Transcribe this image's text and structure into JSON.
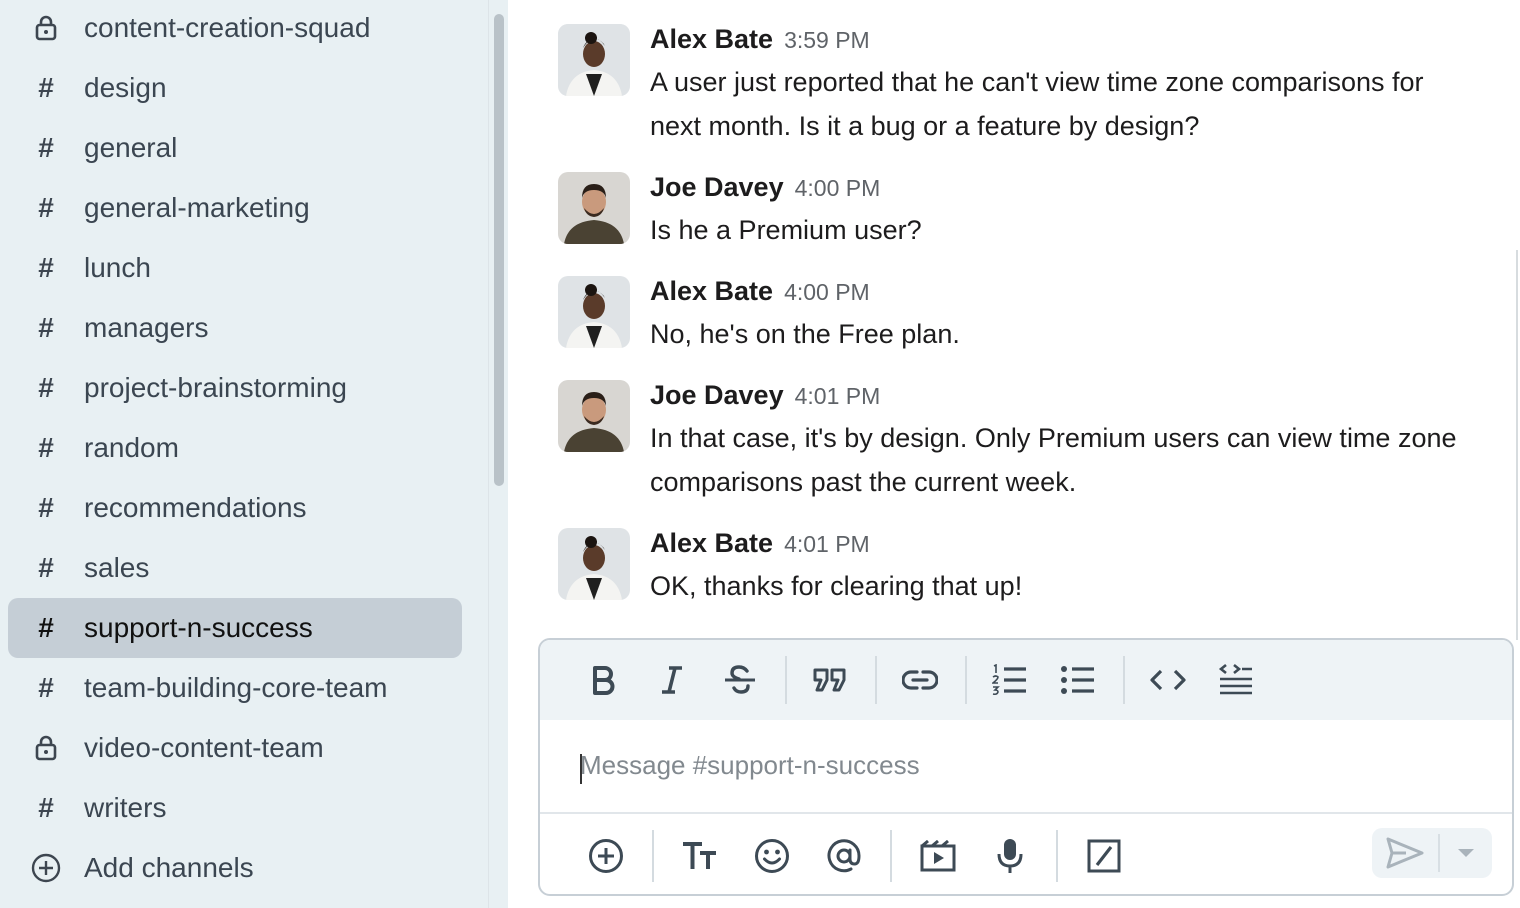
{
  "sidebar": {
    "channels": [
      {
        "label": "content-creation-squad",
        "icon": "lock-icon"
      },
      {
        "label": "design",
        "icon": "hash-icon"
      },
      {
        "label": "general",
        "icon": "hash-icon"
      },
      {
        "label": "general-marketing",
        "icon": "hash-icon"
      },
      {
        "label": "lunch",
        "icon": "hash-icon"
      },
      {
        "label": "managers",
        "icon": "hash-icon"
      },
      {
        "label": "project-brainstorming",
        "icon": "hash-icon"
      },
      {
        "label": "random",
        "icon": "hash-icon"
      },
      {
        "label": "recommendations",
        "icon": "hash-icon"
      },
      {
        "label": "sales",
        "icon": "hash-icon"
      },
      {
        "label": "support-n-success",
        "icon": "hash-icon",
        "active": true
      },
      {
        "label": "team-building-core-team",
        "icon": "hash-icon"
      },
      {
        "label": "video-content-team",
        "icon": "lock-icon"
      },
      {
        "label": "writers",
        "icon": "hash-icon"
      }
    ],
    "add_channels": "Add channels",
    "hash": "#"
  },
  "messages": [
    {
      "author": "Alex Bate",
      "time": "3:59 PM",
      "text": "A user just reported that he can't view time zone comparisons for next month. Is it a bug or a feature by design?"
    },
    {
      "author": "Joe Davey",
      "time": "4:00 PM",
      "text": "Is he a Premium user?"
    },
    {
      "author": "Alex Bate",
      "time": "4:00 PM",
      "text": "No, he's on the Free plan."
    },
    {
      "author": "Joe Davey",
      "time": "4:01 PM",
      "text": "In that case, it's by design. Only Premium users can view time zone comparisons past the current week."
    },
    {
      "author": "Alex Bate",
      "time": "4:01 PM",
      "text": "OK, thanks for clearing that up!"
    }
  ],
  "composer": {
    "placeholder": "Message #support-n-success",
    "toolbar_icons": [
      "bold-icon",
      "italic-icon",
      "strikethrough-icon",
      "quote-icon",
      "link-icon",
      "ordered-list-icon",
      "bulleted-list-icon",
      "code-icon",
      "code-block-icon"
    ],
    "bottom_icons": [
      "plus-icon",
      "text-format-icon",
      "emoji-icon",
      "mention-icon",
      "video-clip-icon",
      "microphone-icon",
      "slash-command-icon",
      "send-icon",
      "chevron-down-icon"
    ]
  },
  "colors": {
    "sidebar_bg": "#e8f0f3",
    "active_channel_bg": "#c5ced6",
    "toolbar_bg": "#eef3f6",
    "send_disabled": "#a9b3bb"
  }
}
